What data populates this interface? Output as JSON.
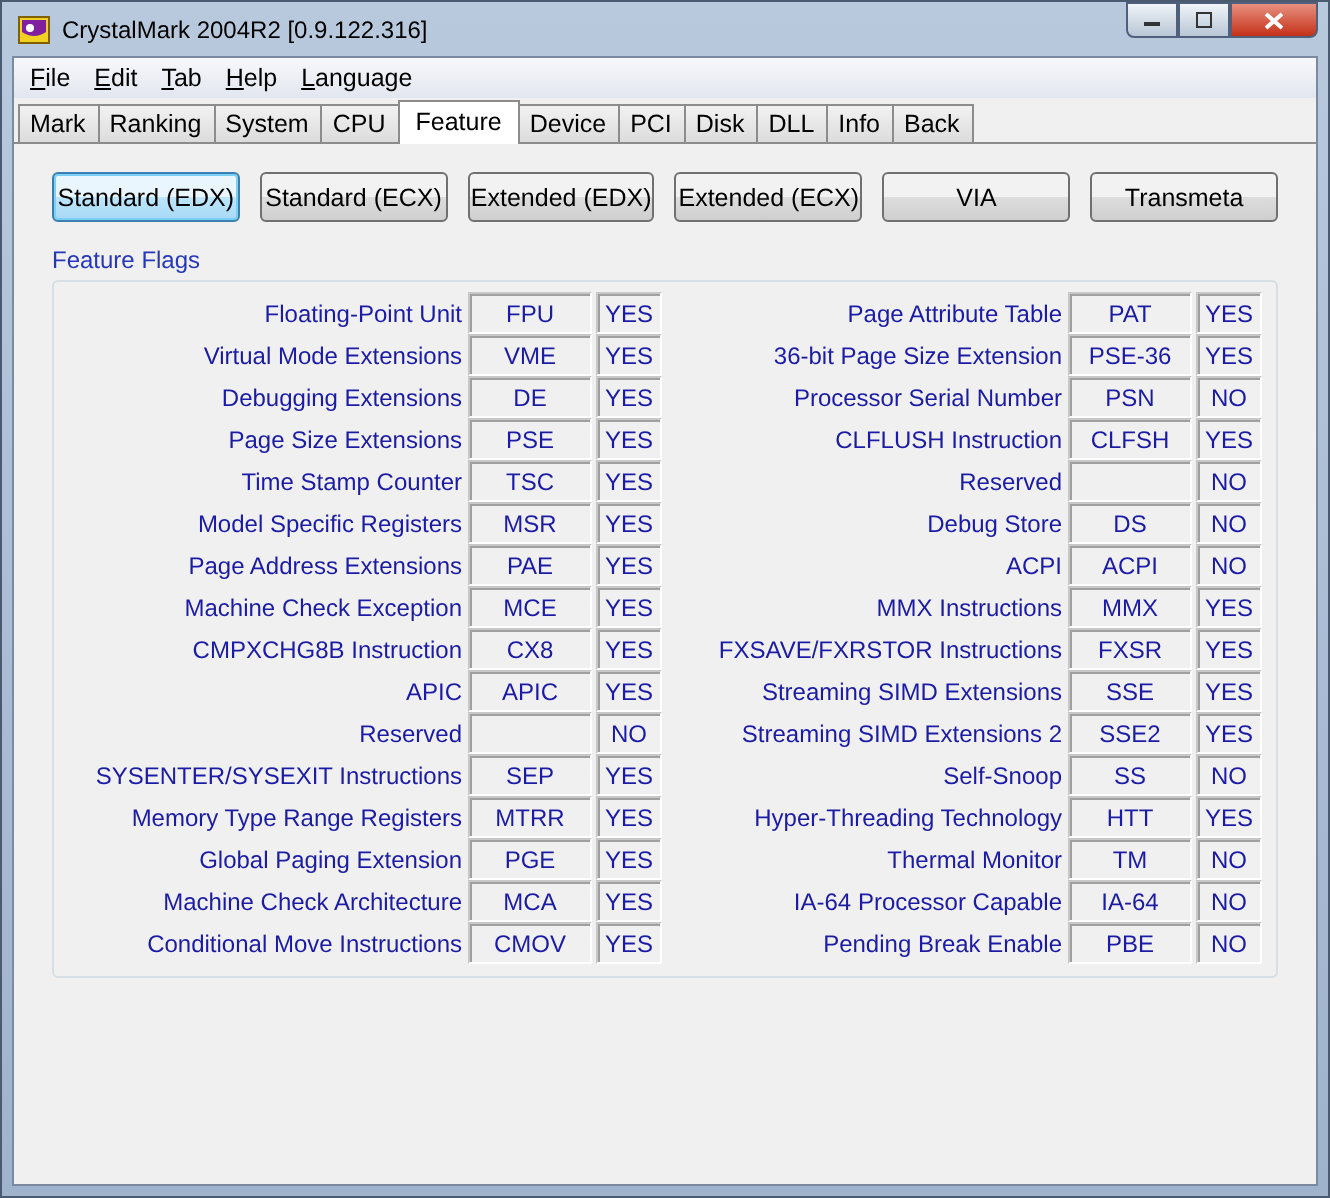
{
  "window": {
    "title": "CrystalMark 2004R2 [0.9.122.316]"
  },
  "menu": [
    "File",
    "Edit",
    "Tab",
    "Help",
    "Language"
  ],
  "tabs": [
    {
      "label": "Mark",
      "selected": false
    },
    {
      "label": "Ranking",
      "selected": false
    },
    {
      "label": "System",
      "selected": false
    },
    {
      "label": "CPU",
      "selected": false
    },
    {
      "label": "Feature",
      "selected": true
    },
    {
      "label": "Device",
      "selected": false
    },
    {
      "label": "PCI",
      "selected": false
    },
    {
      "label": "Disk",
      "selected": false
    },
    {
      "label": "DLL",
      "selected": false
    },
    {
      "label": "Info",
      "selected": false
    },
    {
      "label": "Back",
      "selected": false
    }
  ],
  "buttons": [
    {
      "label": "Standard (EDX)",
      "selected": true
    },
    {
      "label": "Standard (ECX)",
      "selected": false
    },
    {
      "label": "Extended (EDX)",
      "selected": false
    },
    {
      "label": "Extended (ECX)",
      "selected": false
    },
    {
      "label": "VIA",
      "selected": false
    },
    {
      "label": "Transmeta",
      "selected": false
    }
  ],
  "section_title": "Feature Flags",
  "flags_left": [
    {
      "name": "Floating-Point Unit",
      "code": "FPU",
      "value": "YES"
    },
    {
      "name": "Virtual Mode Extensions",
      "code": "VME",
      "value": "YES"
    },
    {
      "name": "Debugging Extensions",
      "code": "DE",
      "value": "YES"
    },
    {
      "name": "Page Size Extensions",
      "code": "PSE",
      "value": "YES"
    },
    {
      "name": "Time Stamp Counter",
      "code": "TSC",
      "value": "YES"
    },
    {
      "name": "Model Specific Registers",
      "code": "MSR",
      "value": "YES"
    },
    {
      "name": "Page Address Extensions",
      "code": "PAE",
      "value": "YES"
    },
    {
      "name": "Machine Check Exception",
      "code": "MCE",
      "value": "YES"
    },
    {
      "name": "CMPXCHG8B Instruction",
      "code": "CX8",
      "value": "YES"
    },
    {
      "name": "APIC",
      "code": "APIC",
      "value": "YES"
    },
    {
      "name": "Reserved",
      "value": "NO"
    },
    {
      "name": "SYSENTER/SYSEXIT Instructions",
      "code": "SEP",
      "value": "YES"
    },
    {
      "name": "Memory Type Range Registers",
      "code": "MTRR",
      "value": "YES"
    },
    {
      "name": "Global Paging Extension",
      "code": "PGE",
      "value": "YES"
    },
    {
      "name": "Machine Check Architecture",
      "code": "MCA",
      "value": "YES"
    },
    {
      "name": "Conditional Move Instructions",
      "code": "CMOV",
      "value": "YES"
    }
  ],
  "flags_right": [
    {
      "name": "Page Attribute Table",
      "code": "PAT",
      "value": "YES"
    },
    {
      "name": "36-bit Page Size Extension",
      "code": "PSE-36",
      "value": "YES"
    },
    {
      "name": "Processor Serial Number",
      "code": "PSN",
      "value": "NO"
    },
    {
      "name": "CLFLUSH Instruction",
      "code": "CLFSH",
      "value": "YES"
    },
    {
      "name": "Reserved",
      "value": "NO"
    },
    {
      "name": "Debug Store",
      "code": "DS",
      "value": "NO"
    },
    {
      "name": "ACPI",
      "code": "ACPI",
      "value": "NO"
    },
    {
      "name": "MMX Instructions",
      "code": "MMX",
      "value": "YES"
    },
    {
      "name": "FXSAVE/FXRSTOR Instructions",
      "code": "FXSR",
      "value": "YES"
    },
    {
      "name": "Streaming SIMD Extensions",
      "code": "SSE",
      "value": "YES"
    },
    {
      "name": "Streaming SIMD Extensions 2",
      "code": "SSE2",
      "value": "YES"
    },
    {
      "name": "Self-Snoop",
      "code": "SS",
      "value": "NO"
    },
    {
      "name": "Hyper-Threading Technology",
      "code": "HTT",
      "value": "YES"
    },
    {
      "name": "Thermal Monitor",
      "code": "TM",
      "value": "NO"
    },
    {
      "name": "IA-64 Processor Capable",
      "code": "IA-64",
      "value": "NO"
    },
    {
      "name": "Pending Break Enable",
      "code": "PBE",
      "value": "NO"
    }
  ]
}
